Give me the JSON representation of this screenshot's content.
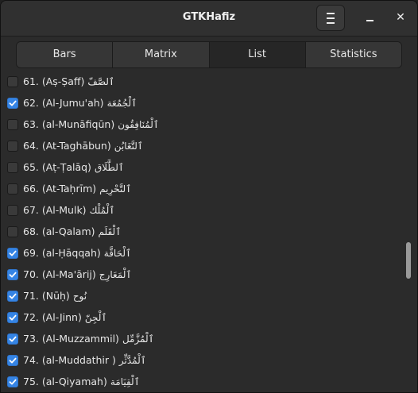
{
  "window": {
    "title": "GTKHafiz"
  },
  "tabs": [
    {
      "label": "Bars"
    },
    {
      "label": "Matrix"
    },
    {
      "label": "List"
    },
    {
      "label": "Statistics"
    }
  ],
  "active_tab": "List",
  "colors": {
    "accent": "#3584e4",
    "background": "#2b2b2b"
  },
  "list": [
    {
      "label": "61. (Aṣ-Ṣaff)",
      "arabic": "ٱلصَّفّ",
      "checked": false
    },
    {
      "label": "62. (Al-Jumu'ah)",
      "arabic": "ٱلْجُمُعَة",
      "checked": true
    },
    {
      "label": "63. (al-Munāfiqūn)",
      "arabic": "ٱلْمُنَافِقُون",
      "checked": false
    },
    {
      "label": "64. (At-Taghābun)",
      "arabic": "ٱلتَّغَابُن",
      "checked": false
    },
    {
      "label": "65. (Aṭ-Ṭalāq)",
      "arabic": "ٱلطَّلَاق",
      "checked": false
    },
    {
      "label": "66. (At-Taḥrīm)",
      "arabic": "ٱلتَّحْرِيم",
      "checked": false
    },
    {
      "label": "67. (Al-Mulk)",
      "arabic": "ٱلْمُلْك",
      "checked": false
    },
    {
      "label": "68. (al-Qalam)",
      "arabic": "ٱلْقَلَم",
      "checked": false
    },
    {
      "label": "69. (al-Ḥāqqah)",
      "arabic": "ٱلْحَاقَّة",
      "checked": true
    },
    {
      "label": "70. (Al-Ma'ārij)",
      "arabic": "ٱلْمَعَارِج",
      "checked": true
    },
    {
      "label": "71. (Nūḥ)",
      "arabic": "نُوح",
      "checked": true
    },
    {
      "label": "72. (Al-Jinn)",
      "arabic": "ٱلْجِنّ",
      "checked": true
    },
    {
      "label": "73. (Al-Muzzammil)",
      "arabic": "ٱلْمُزَّمِّل",
      "checked": true
    },
    {
      "label": "74. (al-Muddathir )",
      "arabic": "ٱلْمُدَّثِّر",
      "checked": true
    },
    {
      "label": "75. (al-Qiyamah)",
      "arabic": "ٱلْقِيَامَة",
      "checked": true
    }
  ]
}
